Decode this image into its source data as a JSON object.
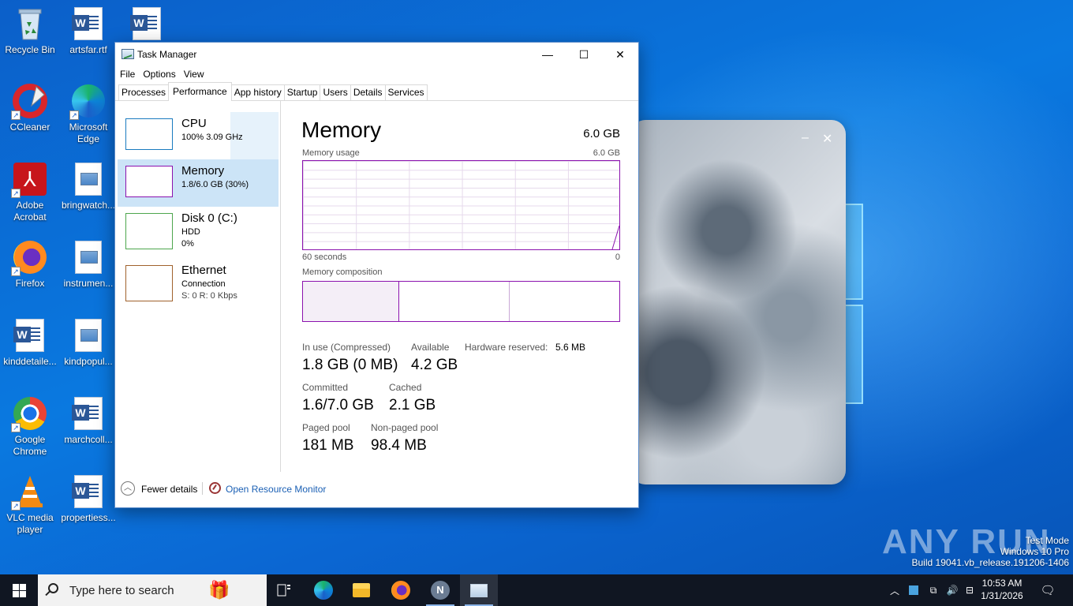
{
  "desktop": {
    "icons": [
      {
        "label": "Recycle Bin",
        "icon": "recycle-bin-icon"
      },
      {
        "label": "artsfar.rtf",
        "icon": "word-document-icon"
      },
      {
        "label": "",
        "icon": "word-document-icon"
      },
      {
        "label": "CCleaner",
        "icon": "ccleaner-icon"
      },
      {
        "label": "Microsoft Edge",
        "icon": "edge-icon"
      },
      {
        "label": "Adobe Acrobat",
        "icon": "acrobat-icon"
      },
      {
        "label": "bringwatch...",
        "icon": "image-document-icon"
      },
      {
        "label": "Firefox",
        "icon": "firefox-icon"
      },
      {
        "label": "instrumen...",
        "icon": "image-document-icon"
      },
      {
        "label": "kinddetaile...",
        "icon": "word-document-icon"
      },
      {
        "label": "kindpopul...",
        "icon": "image-document-icon"
      },
      {
        "label": "Google Chrome",
        "icon": "chrome-icon"
      },
      {
        "label": "marchcoll...",
        "icon": "word-document-icon"
      },
      {
        "label": "VLC media player",
        "icon": "vlc-icon"
      },
      {
        "label": "propertiess...",
        "icon": "word-document-icon"
      }
    ]
  },
  "blur_window": {
    "minimize": "–",
    "close": "✕"
  },
  "task_manager": {
    "title": "Task Manager",
    "controls": {
      "minimize": "—",
      "maximize": "☐",
      "close": "✕"
    },
    "menu": [
      "File",
      "Options",
      "View"
    ],
    "tabs": [
      "Processes",
      "Performance",
      "App history",
      "Startup",
      "Users",
      "Details",
      "Services"
    ],
    "active_tab": "Performance",
    "left_items": [
      {
        "name": "CPU",
        "sub1": "100%  3.09 GHz",
        "sub2": "",
        "color": "#1a7bbf"
      },
      {
        "name": "Memory",
        "sub1": "1.8/6.0 GB (30%)",
        "sub2": "",
        "color": "#8b12ae"
      },
      {
        "name": "Disk 0 (C:)",
        "sub1": "HDD",
        "sub2": "0%",
        "color": "#4da64d"
      },
      {
        "name": "Ethernet",
        "sub1": "Connection",
        "sub2": "S: 0  R: 0 Kbps",
        "color": "#a0622d"
      }
    ],
    "memory": {
      "title": "Memory",
      "total": "6.0 GB",
      "usage_label": "Memory usage",
      "usage_max": "6.0 GB",
      "time_left": "60 seconds",
      "time_right": "0",
      "composition_label": "Memory composition",
      "stats": {
        "in_use_label": "In use (Compressed)",
        "in_use_value": "1.8 GB (0 MB)",
        "available_label": "Available",
        "available_value": "4.2 GB",
        "hw_reserved_label": "Hardware reserved:",
        "hw_reserved_value": "5.6 MB",
        "committed_label": "Committed",
        "committed_value": "1.6/7.0 GB",
        "cached_label": "Cached",
        "cached_value": "2.1 GB",
        "paged_label": "Paged pool",
        "paged_value": "181 MB",
        "nonpaged_label": "Non-paged pool",
        "nonpaged_value": "98.4 MB"
      }
    },
    "footer": {
      "fewer_details": "Fewer details",
      "resource_monitor": "Open Resource Monitor"
    }
  },
  "watermark": {
    "text": "ANY RUN"
  },
  "test_mode": {
    "line1": "Test Mode",
    "line2": "Windows 10 Pro",
    "line3": "Build 19041.vb_release.191206-1406"
  },
  "taskbar": {
    "search_placeholder": "Type here to search",
    "apps": [
      "task-view-icon",
      "edge-icon",
      "file-explorer-icon",
      "firefox-icon",
      "unknown-app-icon",
      "task-manager-icon"
    ],
    "clock_time": "10:53 AM",
    "clock_date": "1/31/2026"
  }
}
